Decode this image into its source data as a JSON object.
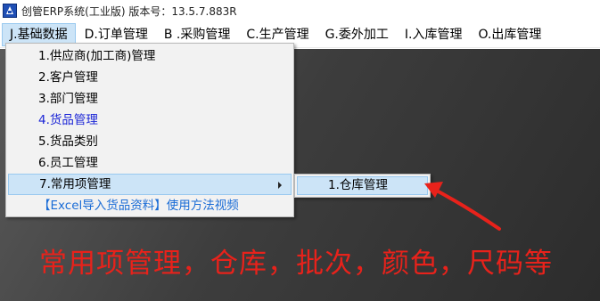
{
  "window": {
    "title": "创管ERP系统(工业版) 版本号：13.5.7.883R"
  },
  "menubar": {
    "items": [
      {
        "label": "J.基础数据"
      },
      {
        "label": "D.订单管理"
      },
      {
        "label": "B .采购管理"
      },
      {
        "label": "C.生产管理"
      },
      {
        "label": "G.委外加工"
      },
      {
        "label": "I.入库管理"
      },
      {
        "label": "O.出库管理"
      }
    ]
  },
  "dropdown": {
    "items": [
      {
        "label": "1.供应商(加工商)管理"
      },
      {
        "label": "2.客户管理"
      },
      {
        "label": "3.部门管理"
      },
      {
        "label": "4.货品管理"
      },
      {
        "label": "5.货品类别"
      },
      {
        "label": "6.员工管理"
      },
      {
        "label": "7.常用项管理"
      },
      {
        "label": "【Excel导入货品资料】使用方法视频"
      }
    ]
  },
  "submenu": {
    "items": [
      {
        "label": "1.仓库管理"
      }
    ]
  },
  "annotation": {
    "text": "常用项管理，仓库，批次，颜色，尺码等",
    "color": "#e8221b"
  },
  "colors": {
    "highlight": "#cce4f7",
    "link_blue": "#1a6cd6",
    "item_blue": "#1a24d6"
  }
}
